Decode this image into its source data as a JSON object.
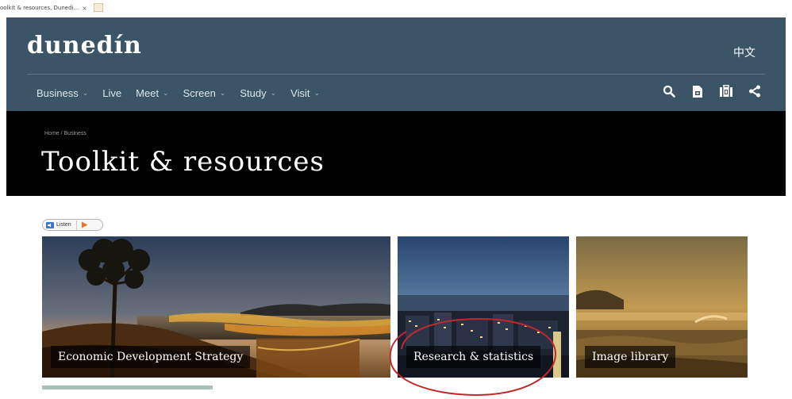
{
  "browser": {
    "tab_title": "oolkit & resources, Dunedi...",
    "tab_close": "×"
  },
  "header": {
    "logo": "dunedín",
    "language_link": "中文",
    "nav": [
      {
        "label": "Business",
        "has_dropdown": true
      },
      {
        "label": "Live",
        "has_dropdown": false
      },
      {
        "label": "Meet",
        "has_dropdown": true
      },
      {
        "label": "Screen",
        "has_dropdown": true
      },
      {
        "label": "Study",
        "has_dropdown": true
      },
      {
        "label": "Visit",
        "has_dropdown": true
      }
    ],
    "tools": [
      "search-icon",
      "document-icon",
      "briefcase-icon",
      "share-icon"
    ]
  },
  "banner": {
    "breadcrumb": "Home / Business",
    "title": "Toolkit & resources"
  },
  "listen": {
    "label": "Listen"
  },
  "tiles": [
    {
      "label": "Economic Development Strategy"
    },
    {
      "label": "Research & statistics"
    },
    {
      "label": "Image library"
    }
  ],
  "colors": {
    "header_bg": "#3b5566",
    "banner_bg": "#020202",
    "annotation_circle": "#c0282d"
  }
}
